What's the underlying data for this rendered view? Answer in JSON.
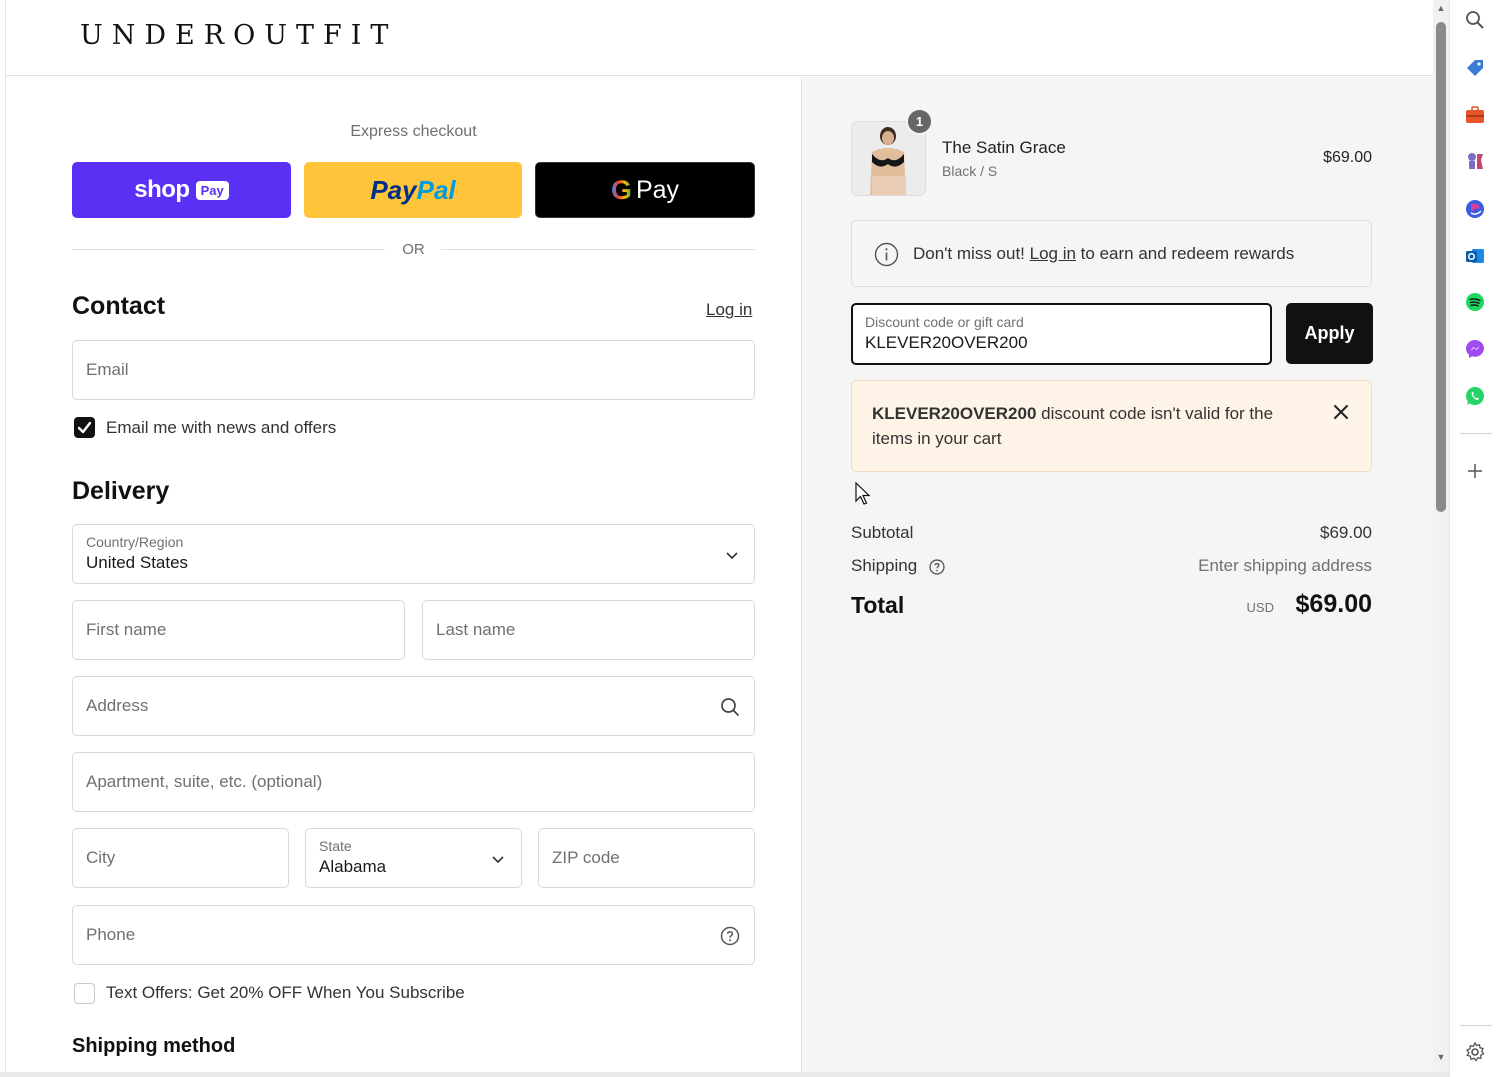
{
  "brand": {
    "logo": "UNDEROUTFIT"
  },
  "express": {
    "title": "Express checkout",
    "shop_word": "shop",
    "shop_pay": "Pay",
    "paypal_1": "Pay",
    "paypal_2": "Pal",
    "gpay_g": "G",
    "gpay_pay": "Pay",
    "or": "OR"
  },
  "contact": {
    "title": "Contact",
    "login": "Log in",
    "email_placeholder": "Email",
    "news_label": "Email me with news and offers",
    "news_checked": true
  },
  "delivery": {
    "title": "Delivery",
    "country_label": "Country/Region",
    "country_value": "United States",
    "first_name": "First name",
    "last_name": "Last name",
    "address": "Address",
    "apartment": "Apartment, suite, etc. (optional)",
    "city": "City",
    "state_label": "State",
    "state_value": "Alabama",
    "zip": "ZIP code",
    "phone": "Phone",
    "text_offers": "Text Offers: Get 20% OFF When You Subscribe",
    "text_offers_checked": false
  },
  "shipping_method": {
    "title": "Shipping method"
  },
  "summary": {
    "item": {
      "quantity": "1",
      "name": "The Satin Grace",
      "variant": "Black / S",
      "price": "$69.00"
    },
    "rewards": {
      "prefix": "Don't miss out! ",
      "link": "Log in",
      "suffix": " to earn and redeem rewards"
    },
    "discount": {
      "label": "Discount code or gift card",
      "value": "KLEVER20OVER200",
      "apply": "Apply"
    },
    "error": {
      "code": "KLEVER20OVER200",
      "message": " discount code isn't valid for the items in your cart"
    },
    "subtotal_label": "Subtotal",
    "subtotal_value": "$69.00",
    "shipping_label": "Shipping",
    "shipping_value": "Enter shipping address",
    "total_label": "Total",
    "total_currency": "USD",
    "total_value": "$69.00"
  },
  "colors": {
    "shop_pay": "#5a31f4",
    "paypal": "#ffc439",
    "gpay": "#000000",
    "error_bg": "#fdf3e7",
    "summary_bg": "#f5f5f5"
  },
  "side_icons": [
    "search-icon",
    "tag-icon",
    "briefcase-icon",
    "chess-icon",
    "copilot-icon",
    "outlook-icon",
    "spotify-icon",
    "messenger-icon",
    "whatsapp-icon",
    "plus-icon",
    "settings-icon"
  ]
}
